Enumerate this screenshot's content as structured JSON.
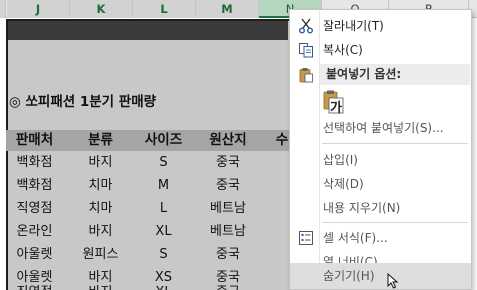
{
  "column_headers": [
    "J",
    "K",
    "L",
    "M",
    "N",
    "O",
    "P"
  ],
  "sheet": {
    "title": "◎ 쏘피패션 1분기 판매량",
    "headers": [
      "판매처",
      "분류",
      "사이즈",
      "원산지",
      "수"
    ],
    "rows": [
      [
        "백화점",
        "바지",
        "S",
        "중국"
      ],
      [
        "백화점",
        "치마",
        "M",
        "중국"
      ],
      [
        "직영점",
        "치마",
        "L",
        "베트남"
      ],
      [
        "온라인",
        "바지",
        "XL",
        "베트남"
      ],
      [
        "아울렛",
        "원피스",
        "S",
        "중국"
      ],
      [
        "아울렛",
        "바지",
        "XS",
        "중국"
      ],
      [
        "직영점",
        "바지",
        "XL",
        "중국"
      ]
    ]
  },
  "context_menu": {
    "cut": "잘라내기(T)",
    "copy": "복사(C)",
    "paste_options": "붙여넣기 옵션:",
    "paste_option_glyph": "가",
    "paste_special": "선택하여 붙여넣기(S)...",
    "insert": "삽입(I)",
    "delete": "삭제(D)",
    "clear_contents": "내용 지우기(N)",
    "format_cells": "셀 서식(F)...",
    "column_width": "열 너비(C)...",
    "hide": "숨기기(H)"
  },
  "colors": {
    "selected_column_header": "#b5d7bf",
    "excel_green": "#217346",
    "selection_gray": "#c8c8c8",
    "menu_hover": "#dedede"
  }
}
